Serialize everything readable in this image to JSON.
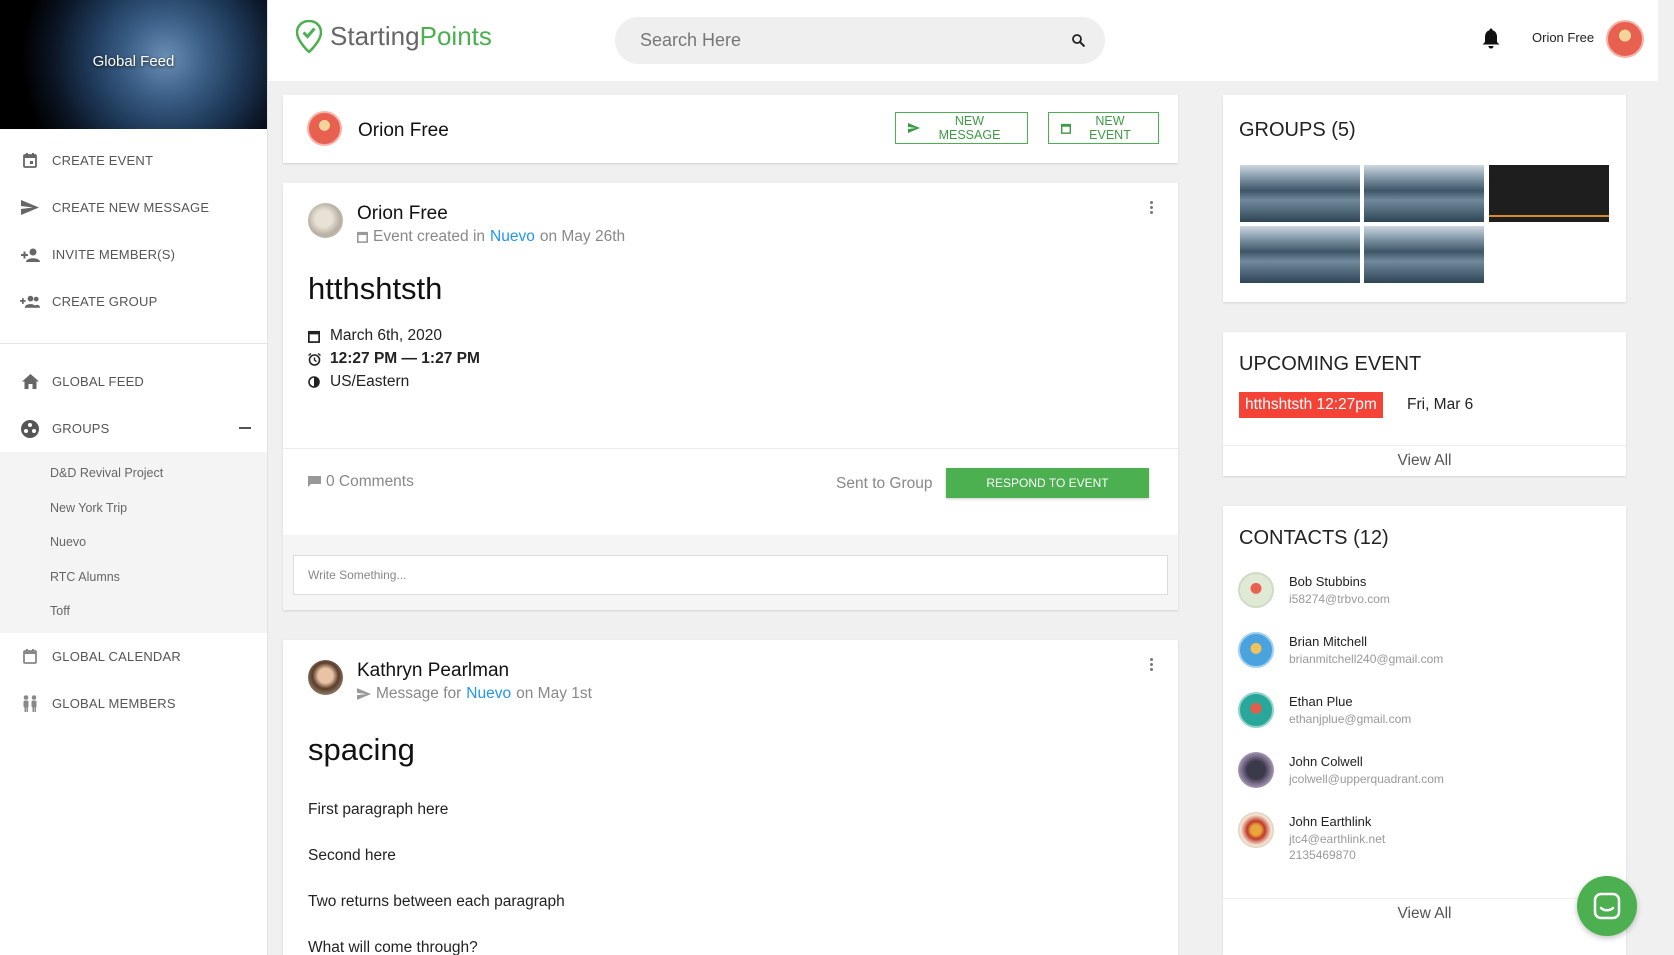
{
  "sidebar": {
    "hero_title": "Global Feed",
    "actions": [
      {
        "label": "CREATE EVENT",
        "icon": "calendar-icon"
      },
      {
        "label": "CREATE NEW MESSAGE",
        "icon": "send-icon"
      },
      {
        "label": "INVITE MEMBER(S)",
        "icon": "person-add-icon"
      },
      {
        "label": "CREATE GROUP",
        "icon": "group-add-icon"
      }
    ],
    "global_feed_label": "GLOBAL FEED",
    "groups_label": "GROUPS",
    "groups": [
      "D&D Revival Project",
      "New York Trip",
      "Nuevo",
      "RTC Alumns",
      "Toff"
    ],
    "global_calendar_label": "GLOBAL CALENDAR",
    "global_members_label": "GLOBAL MEMBERS"
  },
  "topbar": {
    "logo_part1": "Starting",
    "logo_part2": "Points",
    "search_placeholder": "Search Here",
    "user_name": "Orion Free"
  },
  "profile_bar": {
    "name": "Orion Free",
    "new_message_label": "NEW MESSAGE",
    "new_event_label": "NEW EVENT"
  },
  "post1": {
    "author": "Orion Free",
    "meta_prefix": "Event created in",
    "group": "Nuevo",
    "meta_suffix": "on May 26th",
    "title": "htthshtsth",
    "date": "March 6th, 2020",
    "time": "12:27 PM — 1:27 PM",
    "timezone": "US/Eastern",
    "comments": "0 Comments",
    "sent_to": "Sent to Group",
    "respond_label": "RESPOND TO EVENT",
    "write_placeholder": "Write Something..."
  },
  "post2": {
    "author": "Kathryn Pearlman",
    "meta_prefix": "Message for",
    "group": "Nuevo",
    "meta_suffix": "on May 1st",
    "title": "spacing",
    "paragraphs": [
      "First paragraph here",
      "Second here",
      "Two returns between each paragraph",
      "What will come through?"
    ]
  },
  "groups_panel": {
    "title": "GROUPS (5)"
  },
  "upcoming": {
    "title": "UPCOMING EVENT",
    "event_label": "htthshtsth 12:27pm",
    "event_date": "Fri, Mar 6",
    "view_all": "View All"
  },
  "contacts": {
    "title": "CONTACTS (12)",
    "items": [
      {
        "name": "Bob Stubbins",
        "email": "i58274@trbvo.com",
        "phone": ""
      },
      {
        "name": "Brian Mitchell",
        "email": "brianmitchell240@gmail.com",
        "phone": ""
      },
      {
        "name": "Ethan Plue",
        "email": "ethanjplue@gmail.com",
        "phone": ""
      },
      {
        "name": "John Colwell",
        "email": "jcolwell@upperquadrant.com",
        "phone": ""
      },
      {
        "name": "John Earthlink",
        "email": "jtc4@earthlink.net",
        "phone": "2135469870"
      }
    ],
    "view_all": "View All"
  },
  "colors": {
    "accent": "#4caf50",
    "link": "#2196f3",
    "event_badge": "#f44336"
  }
}
